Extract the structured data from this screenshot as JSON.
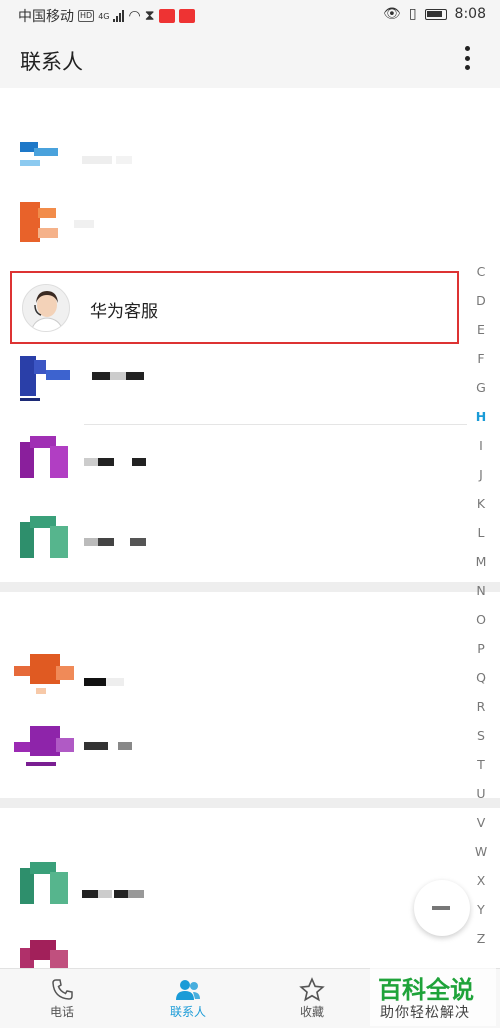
{
  "status_bar": {
    "carrier": "中国移动",
    "network": "4G",
    "time": "8:08"
  },
  "app_bar": {
    "title": "联系人",
    "more_icon": "more-vertical-icon"
  },
  "highlighted_contact": {
    "name": "华为客服",
    "highlight_color": "#dd3333"
  },
  "alphabet_index": {
    "letters": [
      "C",
      "D",
      "E",
      "F",
      "G",
      "H",
      "I",
      "J",
      "K",
      "L",
      "M",
      "N",
      "O",
      "P",
      "Q",
      "R",
      "S",
      "T",
      "U",
      "V",
      "W",
      "X",
      "Y",
      "Z"
    ],
    "active": "H",
    "active_color": "#1a9bd7"
  },
  "tabs": [
    {
      "label": "电话",
      "icon": "phone-icon",
      "active": false
    },
    {
      "label": "联系人",
      "icon": "contacts-icon",
      "active": true
    },
    {
      "label": "收藏",
      "icon": "star-icon",
      "active": false
    }
  ],
  "watermark": {
    "title": "百科全说",
    "subtitle": "助你轻松解决"
  },
  "colors": {
    "accent": "#1a9bd7"
  }
}
